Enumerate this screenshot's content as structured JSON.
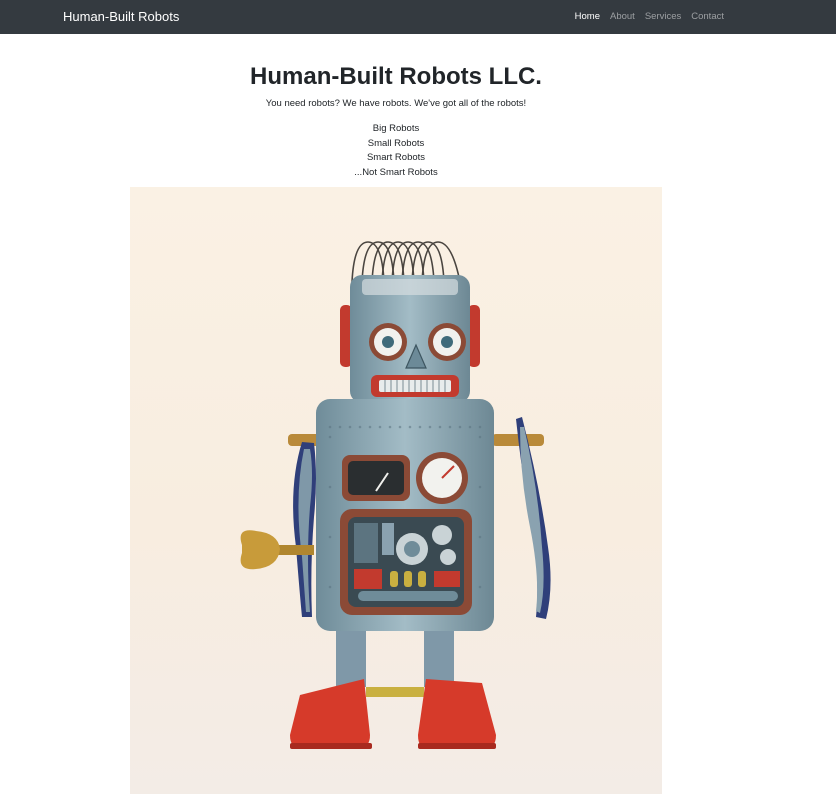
{
  "navbar": {
    "brand": "Human-Built Robots",
    "links": [
      {
        "label": "Home",
        "active": true
      },
      {
        "label": "About",
        "active": false
      },
      {
        "label": "Services",
        "active": false
      },
      {
        "label": "Contact",
        "active": false
      }
    ]
  },
  "main": {
    "title": "Human-Built Robots LLC.",
    "tagline": "You need robots? We have robots. We've got all of the robots!",
    "features": [
      "Big Robots",
      "Small Robots",
      "Smart Robots",
      "...Not Smart Robots"
    ]
  },
  "hero_image": {
    "subject": "vintage tin wind-up robot toy"
  },
  "colors": {
    "navbar_bg": "#343a40",
    "robot_body": "#8fa8b4",
    "robot_feet": "#d63a2a",
    "background_photo": "#f8f0e6"
  }
}
